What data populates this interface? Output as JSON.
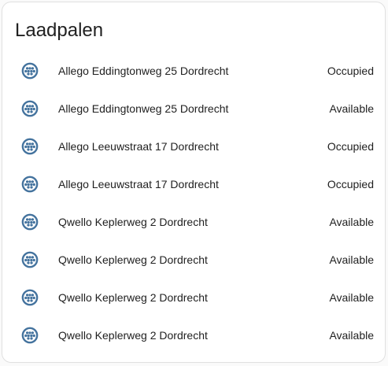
{
  "card": {
    "title": "Laadpalen",
    "icon_color": "#44739e"
  },
  "entities": [
    {
      "icon": "ev-plug-type2-icon",
      "name": "Allego Eddingtonweg 25 Dordrecht",
      "state": "Occupied"
    },
    {
      "icon": "ev-plug-type2-icon",
      "name": "Allego Eddingtonweg 25 Dordrecht",
      "state": "Available"
    },
    {
      "icon": "ev-plug-type2-icon",
      "name": "Allego Leeuwstraat 17 Dordrecht",
      "state": "Occupied"
    },
    {
      "icon": "ev-plug-type2-icon",
      "name": "Allego Leeuwstraat 17 Dordrecht",
      "state": "Occupied"
    },
    {
      "icon": "ev-plug-type2-icon",
      "name": "Qwello Keplerweg 2 Dordrecht",
      "state": "Available"
    },
    {
      "icon": "ev-plug-type2-icon",
      "name": "Qwello Keplerweg 2 Dordrecht",
      "state": "Available"
    },
    {
      "icon": "ev-plug-type2-icon",
      "name": "Qwello Keplerweg 2 Dordrecht",
      "state": "Available"
    },
    {
      "icon": "ev-plug-type2-icon",
      "name": "Qwello Keplerweg 2 Dordrecht",
      "state": "Available"
    }
  ]
}
